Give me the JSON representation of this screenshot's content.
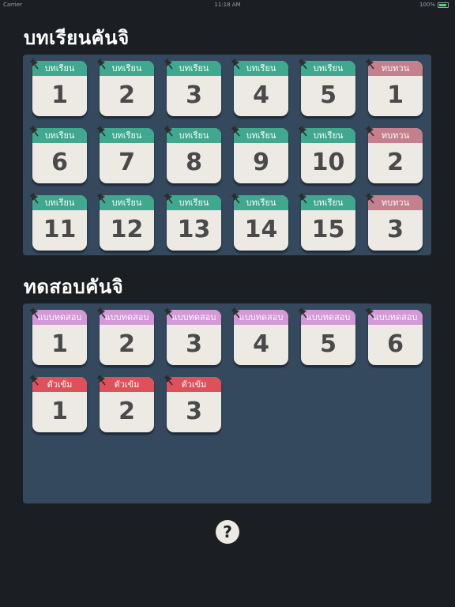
{
  "status_bar": {
    "carrier": "Carrier",
    "time": "11:18 AM",
    "battery": "100%"
  },
  "lessons_section": {
    "title": "บทเรียนคันจิ",
    "cards": [
      {
        "label": "บทเรียน",
        "number": "1",
        "color": "green"
      },
      {
        "label": "บทเรียน",
        "number": "2",
        "color": "green"
      },
      {
        "label": "บทเรียน",
        "number": "3",
        "color": "green"
      },
      {
        "label": "บทเรียน",
        "number": "4",
        "color": "green"
      },
      {
        "label": "บทเรียน",
        "number": "5",
        "color": "green"
      },
      {
        "label": "ทบทวน",
        "number": "1",
        "color": "pink"
      },
      {
        "label": "บทเรียน",
        "number": "6",
        "color": "green"
      },
      {
        "label": "บทเรียน",
        "number": "7",
        "color": "green"
      },
      {
        "label": "บทเรียน",
        "number": "8",
        "color": "green"
      },
      {
        "label": "บทเรียน",
        "number": "9",
        "color": "green"
      },
      {
        "label": "บทเรียน",
        "number": "10",
        "color": "green"
      },
      {
        "label": "ทบทวน",
        "number": "2",
        "color": "pink"
      },
      {
        "label": "บทเรียน",
        "number": "11",
        "color": "green"
      },
      {
        "label": "บทเรียน",
        "number": "12",
        "color": "green"
      },
      {
        "label": "บทเรียน",
        "number": "13",
        "color": "green"
      },
      {
        "label": "บทเรียน",
        "number": "14",
        "color": "green"
      },
      {
        "label": "บทเรียน",
        "number": "15",
        "color": "green"
      },
      {
        "label": "ทบทวน",
        "number": "3",
        "color": "pink"
      }
    ]
  },
  "tests_section": {
    "title": "ทดสอบคันจิ",
    "cards": [
      {
        "label": "แบบทดสอบ",
        "number": "1",
        "color": "purple"
      },
      {
        "label": "แบบทดสอบ",
        "number": "2",
        "color": "purple"
      },
      {
        "label": "แบบทดสอบ",
        "number": "3",
        "color": "purple"
      },
      {
        "label": "แบบทดสอบ",
        "number": "4",
        "color": "purple"
      },
      {
        "label": "แบบทดสอบ",
        "number": "5",
        "color": "purple"
      },
      {
        "label": "แบบทดสอบ",
        "number": "6",
        "color": "purple"
      },
      {
        "label": "ตัวเข้ม",
        "number": "1",
        "color": "red"
      },
      {
        "label": "ตัวเข้ม",
        "number": "2",
        "color": "red"
      },
      {
        "label": "ตัวเข้ม",
        "number": "3",
        "color": "red"
      }
    ]
  },
  "help_button": {
    "label": "?",
    "icon": "question-mark-icon"
  },
  "colors": {
    "background": "#1b1f24",
    "panel": "#34495e",
    "card": "#eceae3",
    "green": "#3fa88e",
    "pink": "#c4808d",
    "purple": "#d49ad7",
    "red": "#e0505a",
    "number": "#4a4a4a"
  }
}
